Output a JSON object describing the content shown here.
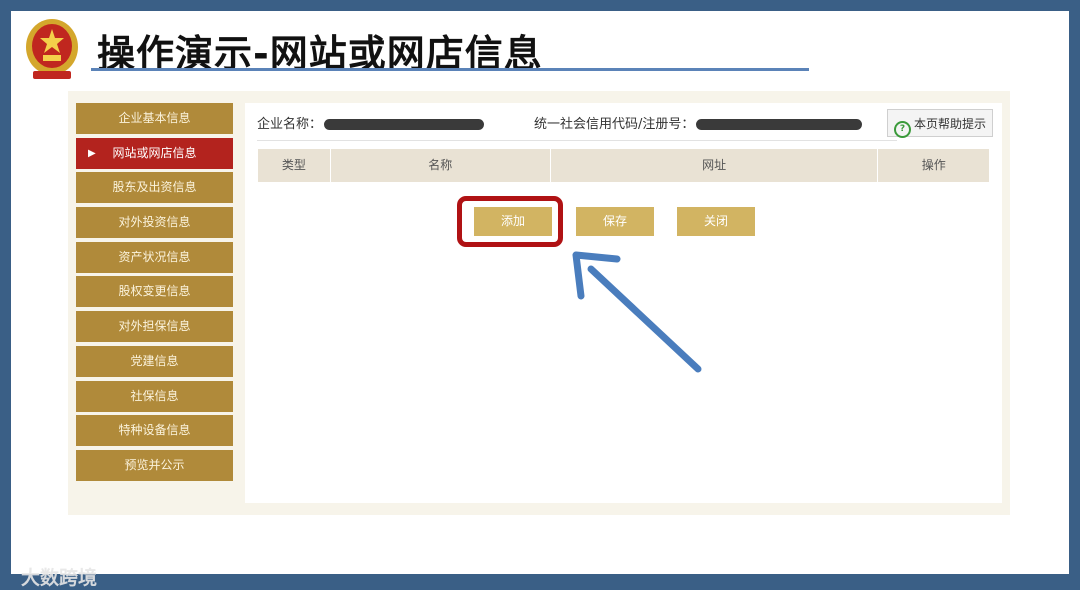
{
  "slide": {
    "title": "操作演示-网站或网店信息",
    "watermark": "大数跨境"
  },
  "sidebar": {
    "items": [
      {
        "label": "企业基本信息",
        "active": false
      },
      {
        "label": "网站或网店信息",
        "active": true
      },
      {
        "label": "股东及出资信息",
        "active": false
      },
      {
        "label": "对外投资信息",
        "active": false
      },
      {
        "label": "资产状况信息",
        "active": false
      },
      {
        "label": "股权变更信息",
        "active": false
      },
      {
        "label": "对外担保信息",
        "active": false
      },
      {
        "label": "党建信息",
        "active": false
      },
      {
        "label": "社保信息",
        "active": false
      },
      {
        "label": "特种设备信息",
        "active": false
      },
      {
        "label": "预览并公示",
        "active": false
      }
    ]
  },
  "header": {
    "company_label": "企业名称：",
    "credit_label": "统一社会信用代码/注册号：",
    "help_button": "本页帮助提示"
  },
  "table": {
    "columns": [
      "类型",
      "名称",
      "网址",
      "操作"
    ]
  },
  "actions": {
    "add": "添加",
    "save": "保存",
    "close": "关闭"
  },
  "colors": {
    "sidebar": "#b08a3a",
    "sidebar_active": "#b3231e",
    "action_button": "#d2b462",
    "highlight": "#b01214",
    "annotation_arrow": "#4a7dbd"
  }
}
